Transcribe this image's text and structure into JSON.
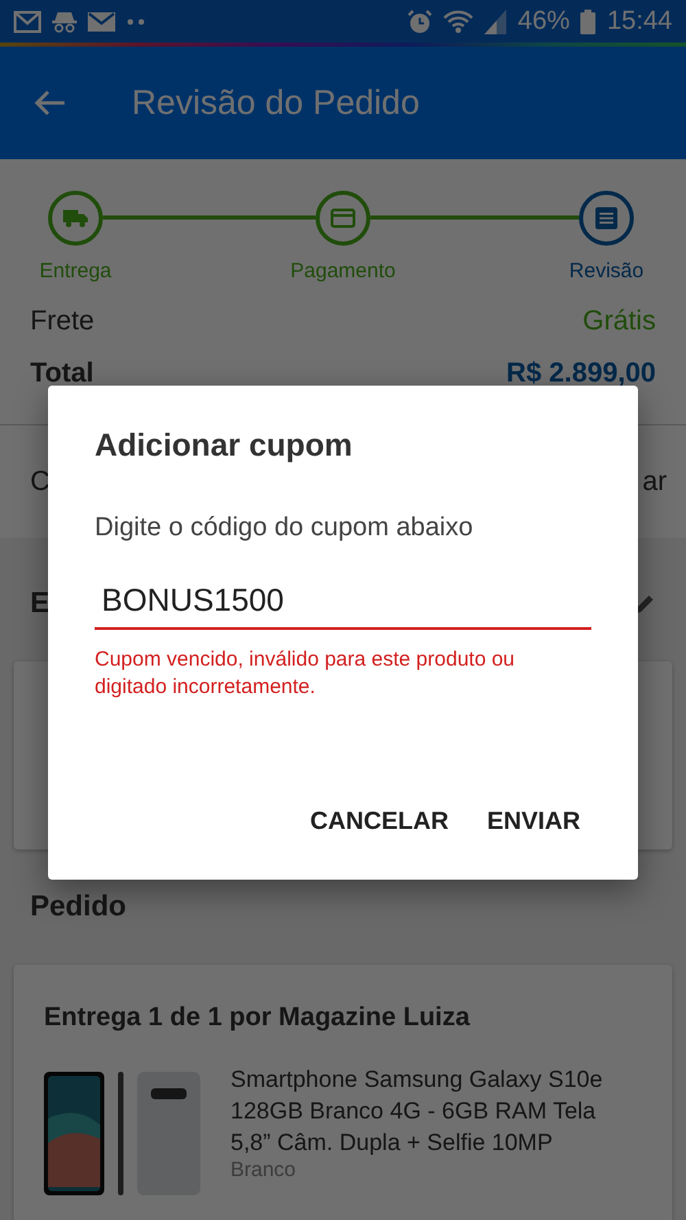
{
  "status_bar": {
    "battery": "46%",
    "time": "15:44"
  },
  "app_bar": {
    "title": "Revisão do Pedido"
  },
  "steps": [
    {
      "label": "Entrega",
      "selected": false
    },
    {
      "label": "Pagamento",
      "selected": false
    },
    {
      "label": "Revisão",
      "selected": true
    }
  ],
  "summary": [
    {
      "label": "Frete",
      "value": "Grátis",
      "kind": "free"
    },
    {
      "label": "Total",
      "value": "R$ 2.899,00",
      "kind": "total"
    }
  ],
  "coupon_row": {
    "label": "C",
    "action": "ar"
  },
  "address_section": {
    "title": "E"
  },
  "order_section": {
    "title": "Pedido",
    "delivery": "Entrega 1 de 1 por Magazine Luiza",
    "product": {
      "name": "Smartphone Samsung Galaxy S10e 128GB Branco 4G - 6GB RAM Tela 5,8” Câm. Dupla + Selfie 10MP",
      "variant": "Branco"
    }
  },
  "dialog": {
    "title": "Adicionar cupom",
    "message": "Digite o código do cupom abaixo",
    "value": "BONUS1500",
    "error": "Cupom vencido, inválido para este produto ou digitado incorretamente.",
    "buttons": [
      "CANCELAR",
      "ENVIAR"
    ]
  }
}
